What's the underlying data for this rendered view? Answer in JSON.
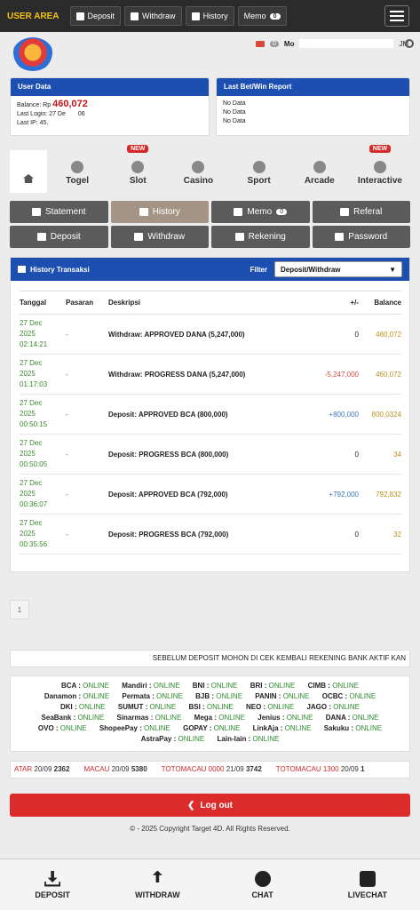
{
  "topbar": {
    "brand": "USER AREA",
    "deposit": "Deposit",
    "withdraw": "Withdraw",
    "history": "History",
    "memo": "Memo",
    "memo_count": "0"
  },
  "header": {
    "mail_count": "0",
    "username": "Mo",
    "username_suffix": "JM"
  },
  "userdata": {
    "title": "User Data",
    "balance_label": "Balance: Rp",
    "balance_value": "460,072",
    "last_login_label": "Last Login: 27 De",
    "last_login_suffix": "06",
    "last_ip": "Last IP: 45."
  },
  "betwin": {
    "title": "Last Bet/Win Report",
    "rows": [
      "No Data",
      "No Data",
      "No Data"
    ]
  },
  "tabs": {
    "home": "",
    "togel": "Togel",
    "slot": "Slot",
    "casino": "Casino",
    "sport": "Sport",
    "arcade": "Arcade",
    "interactive": "Interactive",
    "new_tag": "NEW"
  },
  "actions": {
    "statement": "Statement",
    "history": "History",
    "memo": "Memo",
    "memo_count": "0",
    "referal": "Referal",
    "deposit": "Deposit",
    "withdraw": "Withdraw",
    "rekening": "Rekening",
    "password": "Password"
  },
  "history": {
    "title": "History Transaksi",
    "filter_label": "Filter",
    "filter_value": "Deposit/Withdraw",
    "columns": {
      "tanggal": "Tanggal",
      "pasaran": "Pasaran",
      "deskripsi": "Deskripsi",
      "change": "+/-",
      "balance": "Balance"
    },
    "rows": [
      {
        "d1": "27 Dec",
        "d2": "2025",
        "d3": "02:14:21",
        "pasaran": "-",
        "desc": "Withdraw: APPROVED DANA (5,247,000)",
        "change": "0",
        "balance": "460,072"
      },
      {
        "d1": "27 Dec",
        "d2": "2025",
        "d3": "01:17:03",
        "pasaran": "-",
        "desc": "Withdraw: PROGRESS DANA (5,247,000)",
        "change": "-5,247,000",
        "balance": "460,072"
      },
      {
        "d1": "27 Dec",
        "d2": "2025",
        "d3": "00:50:15",
        "pasaran": "-",
        "desc": "Deposit: APPROVED BCA (800,000)",
        "change": "+800,000",
        "balance": "800,0324"
      },
      {
        "d1": "27 Dec",
        "d2": "2025",
        "d3": "00:50:05",
        "pasaran": "-",
        "desc": "Deposit: PROGRESS BCA (800,000)",
        "change": "0",
        "balance": "34"
      },
      {
        "d1": "27 Dec",
        "d2": "2025",
        "d3": "00:36:07",
        "pasaran": "-",
        "desc": "Deposit: APPROVED BCA (792,000)",
        "change": "+792,000",
        "balance": "792,832"
      },
      {
        "d1": "27 Dec",
        "d2": "2025",
        "d3": "00:35:56",
        "pasaran": "-",
        "desc": "Deposit: PROGRESS BCA (792,000)",
        "change": "0",
        "balance": "32"
      }
    ]
  },
  "pager": "1",
  "marquee": "SEBELUM DEPOSIT MOHON DI CEK KEMBALI REKENING BANK AKTIF KAN",
  "banks": {
    "status": "ONLINE",
    "list": [
      "BCA",
      "Mandiri",
      "BNI",
      "BRI",
      "CIMB",
      "Danamon",
      "Permata",
      "BJB",
      "PANIN",
      "OCBC",
      "DKI",
      "SUMUT",
      "BSI",
      "NEO",
      "JAGO",
      "SeaBank",
      "Sinarmas",
      "Mega",
      "Jenius",
      "DANA",
      "OVO",
      "ShopeePay",
      "GOPAY",
      "LinkAja",
      "Sakuku",
      "AstraPay",
      "Lain-lain"
    ]
  },
  "results": [
    {
      "market": "ATAR",
      "date": "20/09",
      "number": "2362"
    },
    {
      "market": "MACAU",
      "date": "20/09",
      "number": "5380"
    },
    {
      "market": "TOTOMACAU 0000",
      "date": "21/09",
      "number": "3742"
    },
    {
      "market": "TOTOMACAU 1300",
      "date": "20/09",
      "number": "1"
    }
  ],
  "logout": "Log out",
  "copyright": "© - 2025 Copyright Target 4D. All Rights Reserved.",
  "bottomnav": {
    "deposit": "DEPOSIT",
    "withdraw": "WITHDRAW",
    "chat": "CHAT",
    "livechat": "LIVECHAT"
  },
  "colors": {
    "brand_yellow": "#f3c316",
    "header_blue": "#1d4fb0",
    "logout_red": "#dc2b2b",
    "online_green": "#2e8a2e"
  }
}
